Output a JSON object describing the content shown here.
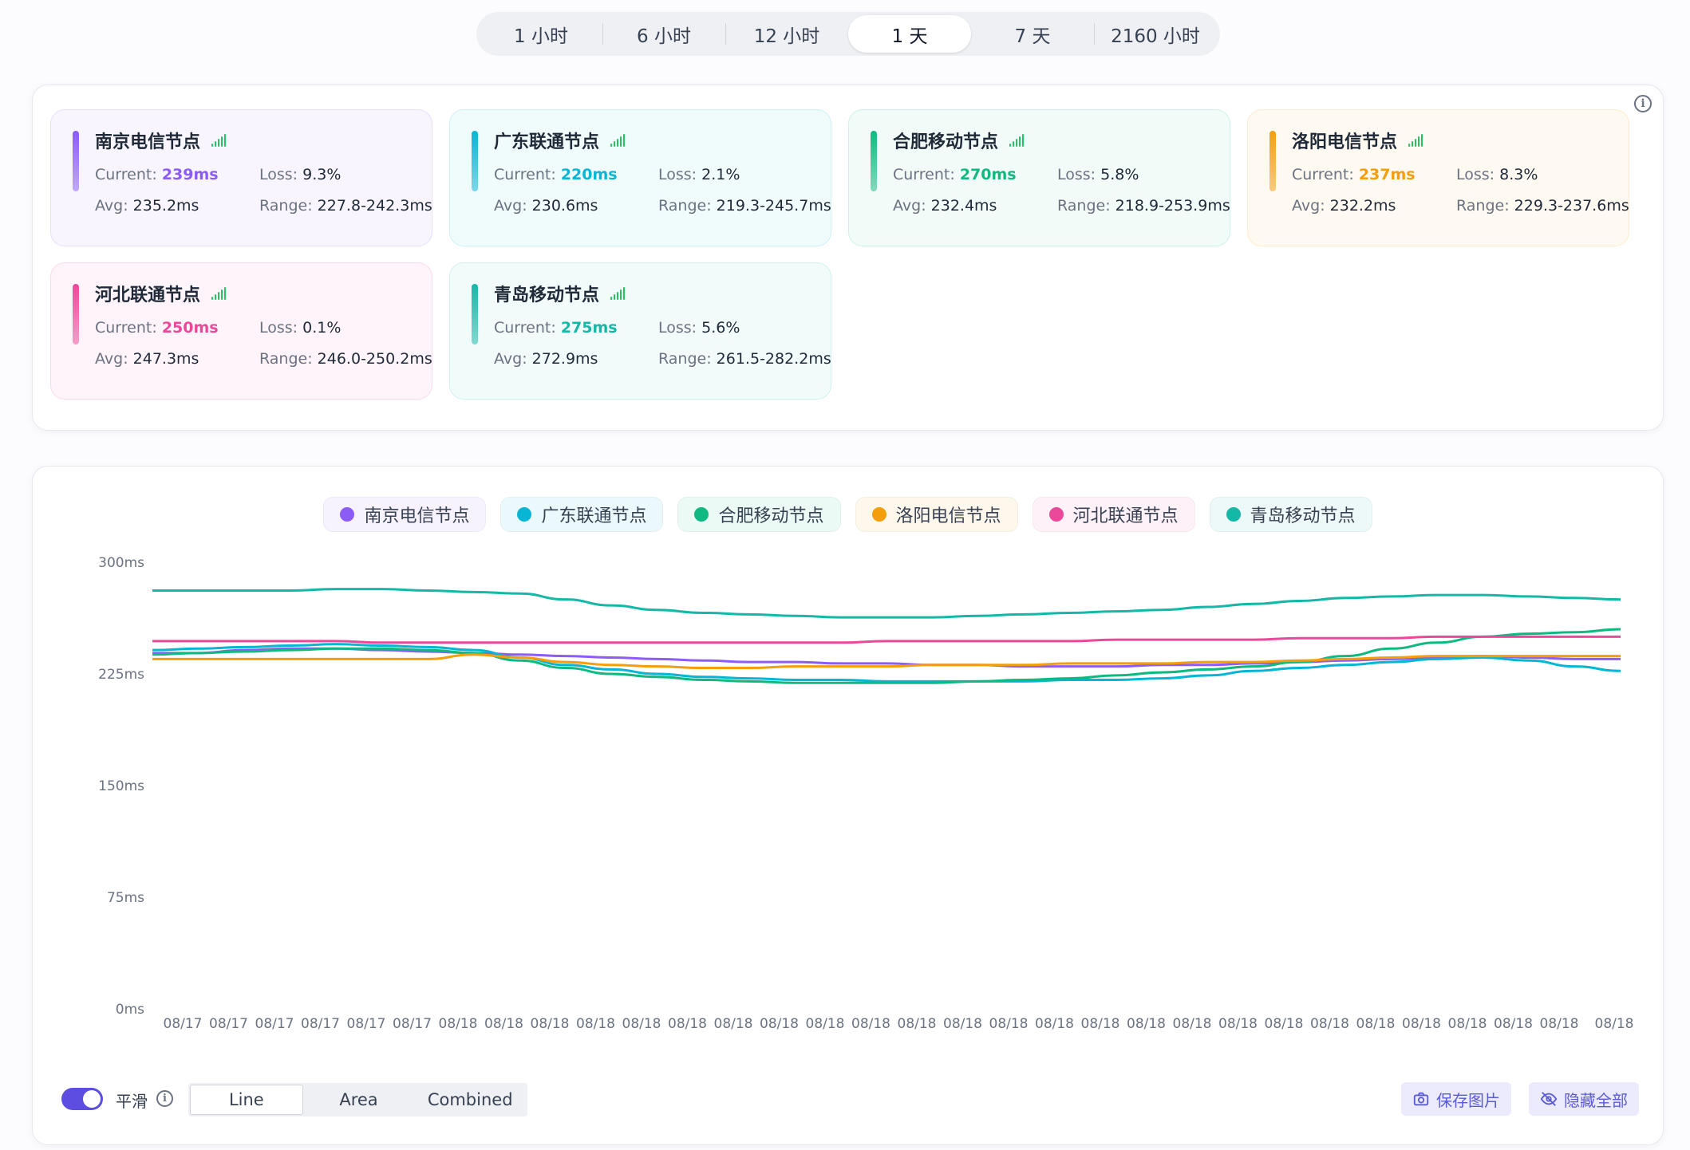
{
  "time_range": {
    "options": [
      "1 小时",
      "6 小时",
      "12 小时",
      "1 天",
      "7 天",
      "2160 小时"
    ],
    "selected": "1 天"
  },
  "nodes": [
    {
      "name": "南京电信节点",
      "color": "#8b5cf6",
      "current": "239ms",
      "loss": "9.3%",
      "avg": "235.2ms",
      "range": "227.8-242.3ms"
    },
    {
      "name": "广东联通节点",
      "color": "#06b6d4",
      "current": "220ms",
      "loss": "2.1%",
      "avg": "230.6ms",
      "range": "219.3-245.7ms"
    },
    {
      "name": "合肥移动节点",
      "color": "#10b981",
      "current": "270ms",
      "loss": "5.8%",
      "avg": "232.4ms",
      "range": "218.9-253.9ms"
    },
    {
      "name": "洛阳电信节点",
      "color": "#f59e0b",
      "current": "237ms",
      "loss": "8.3%",
      "avg": "232.2ms",
      "range": "229.3-237.6ms"
    },
    {
      "name": "河北联通节点",
      "color": "#ec4899",
      "current": "250ms",
      "loss": "0.1%",
      "avg": "247.3ms",
      "range": "246.0-250.2ms"
    },
    {
      "name": "青岛移动节点",
      "color": "#14b8a6",
      "current": "275ms",
      "loss": "5.6%",
      "avg": "272.9ms",
      "range": "261.5-282.2ms"
    }
  ],
  "stat_labels": {
    "current": "Current:",
    "loss": "Loss:",
    "avg": "Avg:",
    "range": "Range:"
  },
  "chart_data": {
    "type": "line",
    "ylim": [
      0,
      300
    ],
    "y_ticks": [
      "300ms",
      "225ms",
      "150ms",
      "75ms",
      "0ms"
    ],
    "x_tick_labels": [
      "08/17",
      "08/17",
      "08/17",
      "08/17",
      "08/17",
      "08/17",
      "08/18",
      "08/18",
      "08/18",
      "08/18",
      "08/18",
      "08/18",
      "08/18",
      "08/18",
      "08/18",
      "08/18",
      "08/18",
      "08/18",
      "08/18",
      "08/18",
      "08/18",
      "08/18",
      "08/18",
      "08/18",
      "08/18",
      "08/18",
      "08/18",
      "08/18",
      "08/18",
      "08/18",
      "08/18",
      "08/18"
    ],
    "grid": false,
    "legend_position": "top-center",
    "series": [
      {
        "name": "南京电信节点",
        "color": "#8b5cf6",
        "values": [
          239,
          239,
          241,
          242,
          242,
          241,
          240,
          239,
          238,
          237,
          236,
          235,
          234,
          233,
          233,
          232,
          232,
          231,
          231,
          230,
          230,
          230,
          231,
          231,
          232,
          233,
          234,
          235,
          236,
          237,
          236,
          235,
          235
        ]
      },
      {
        "name": "广东联通节点",
        "color": "#06b6d4",
        "values": [
          241,
          242,
          243,
          244,
          245,
          244,
          243,
          241,
          236,
          231,
          228,
          225,
          223,
          222,
          221,
          221,
          220,
          220,
          220,
          220,
          221,
          221,
          222,
          224,
          227,
          229,
          231,
          233,
          235,
          236,
          234,
          230,
          227
        ]
      },
      {
        "name": "合肥移动节点",
        "color": "#10b981",
        "values": [
          238,
          239,
          240,
          241,
          242,
          242,
          241,
          239,
          234,
          229,
          225,
          223,
          221,
          220,
          219,
          219,
          219,
          219,
          220,
          221,
          222,
          224,
          226,
          228,
          230,
          233,
          237,
          242,
          246,
          250,
          252,
          253,
          255
        ]
      },
      {
        "name": "洛阳电信节点",
        "color": "#f59e0b",
        "values": [
          235,
          235,
          235,
          235,
          235,
          235,
          235,
          238,
          236,
          233,
          231,
          230,
          229,
          229,
          230,
          230,
          230,
          231,
          231,
          231,
          232,
          232,
          232,
          233,
          233,
          234,
          235,
          236,
          237,
          237,
          237,
          237,
          237
        ]
      },
      {
        "name": "河北联通节点",
        "color": "#ec4899",
        "values": [
          247,
          247,
          247,
          247,
          247,
          246,
          246,
          246,
          246,
          246,
          246,
          246,
          246,
          246,
          246,
          246,
          247,
          247,
          247,
          247,
          247,
          248,
          248,
          248,
          248,
          249,
          249,
          249,
          250,
          250,
          250,
          250,
          250
        ]
      },
      {
        "name": "青岛移动节点",
        "color": "#14b8a6",
        "values": [
          281,
          281,
          281,
          281,
          282,
          282,
          281,
          280,
          279,
          275,
          271,
          268,
          266,
          265,
          264,
          263,
          263,
          263,
          264,
          265,
          266,
          267,
          268,
          270,
          272,
          274,
          276,
          277,
          278,
          278,
          277,
          276,
          275
        ]
      }
    ]
  },
  "bottom_bar": {
    "smooth_label": "平滑",
    "modes": [
      "Line",
      "Area",
      "Combined"
    ],
    "active_mode": "Line",
    "save_label": "保存图片",
    "hide_all_label": "隐藏全部"
  }
}
